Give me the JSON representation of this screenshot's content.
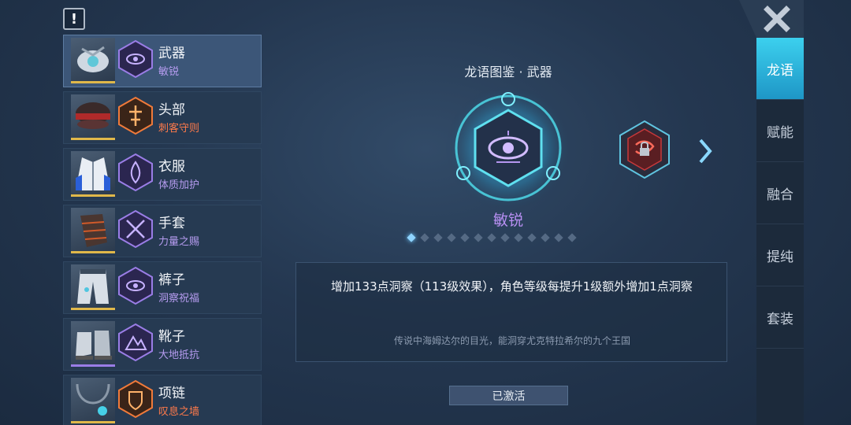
{
  "alert_icon_label": "!",
  "equipment": [
    {
      "name": "武器",
      "sub": "敏锐",
      "sub_color": "#b69cf0",
      "bar_color": "#e0b84a",
      "rune_color": "#9a7de6",
      "selected": true
    },
    {
      "name": "头部",
      "sub": "刺客守则",
      "sub_color": "#ff7a4a",
      "bar_color": "#e0b84a",
      "rune_color": "#f07a3a",
      "selected": false
    },
    {
      "name": "衣服",
      "sub": "体质加护",
      "sub_color": "#b69cf0",
      "bar_color": "#e0b84a",
      "rune_color": "#9a7de6",
      "selected": false
    },
    {
      "name": "手套",
      "sub": "力量之赐",
      "sub_color": "#b69cf0",
      "bar_color": "#e0b84a",
      "rune_color": "#9a7de6",
      "selected": false
    },
    {
      "name": "裤子",
      "sub": "洞察祝福",
      "sub_color": "#b69cf0",
      "bar_color": "#e0b84a",
      "rune_color": "#9a7de6",
      "selected": false
    },
    {
      "name": "靴子",
      "sub": "大地抵抗",
      "sub_color": "#b69cf0",
      "bar_color": "#9a7de6",
      "rune_color": "#9a7de6",
      "selected": false
    },
    {
      "name": "项链",
      "sub": "叹息之墙",
      "sub_color": "#ff7a4a",
      "bar_color": "#e0b84a",
      "rune_color": "#f07a3a",
      "selected": false
    }
  ],
  "detail": {
    "title": "龙语图鉴 · 武器",
    "rune_name": "敏锐",
    "description": "增加133点洞察（113级效果），角色等级每提升1级额外增加1点洞察",
    "lore": "传说中海姆达尔的目光，能洞穿尤克特拉希尔的九个王国",
    "activate_label": "已激活",
    "page_count": 13,
    "active_page": 1
  },
  "tabs": [
    {
      "label": "龙语",
      "active": true
    },
    {
      "label": "赋能",
      "active": false
    },
    {
      "label": "融合",
      "active": false
    },
    {
      "label": "提纯",
      "active": false
    },
    {
      "label": "套装",
      "active": false
    }
  ],
  "colors": {
    "accent_cyan": "#3cd0ee",
    "rune_purple": "#9a7de6",
    "rune_orange": "#f07a3a"
  },
  "icons": {
    "close": "close-x-icon",
    "next": "chevron-right-icon",
    "alert": "exclamation-icon"
  }
}
